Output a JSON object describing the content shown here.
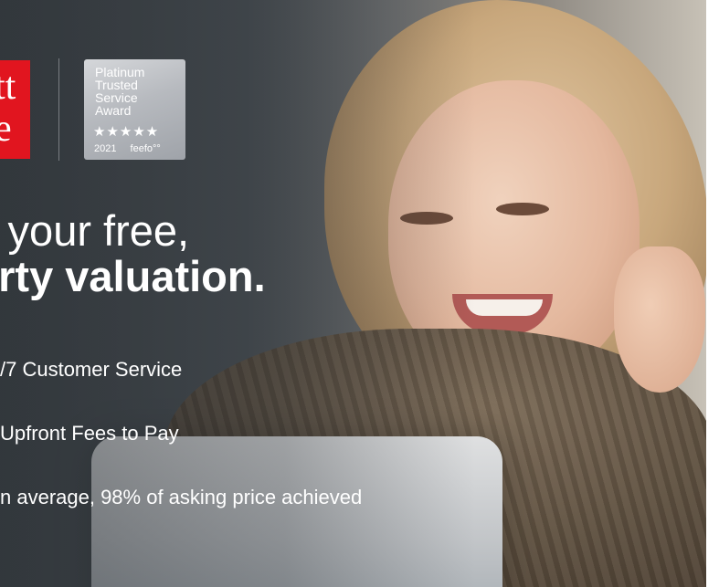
{
  "logo": {
    "text": "tt\ne"
  },
  "award": {
    "lines": [
      "Platinum",
      "Trusted",
      "Service",
      "Award"
    ],
    "stars": "★★★★★",
    "year": "2021",
    "brand": "feefo°°"
  },
  "headline": {
    "line1": "k your free,",
    "line2": "erty valuation."
  },
  "benefits": [
    "/7 Customer Service",
    "Upfront Fees to Pay",
    "n average, 98% of asking price achieved"
  ]
}
